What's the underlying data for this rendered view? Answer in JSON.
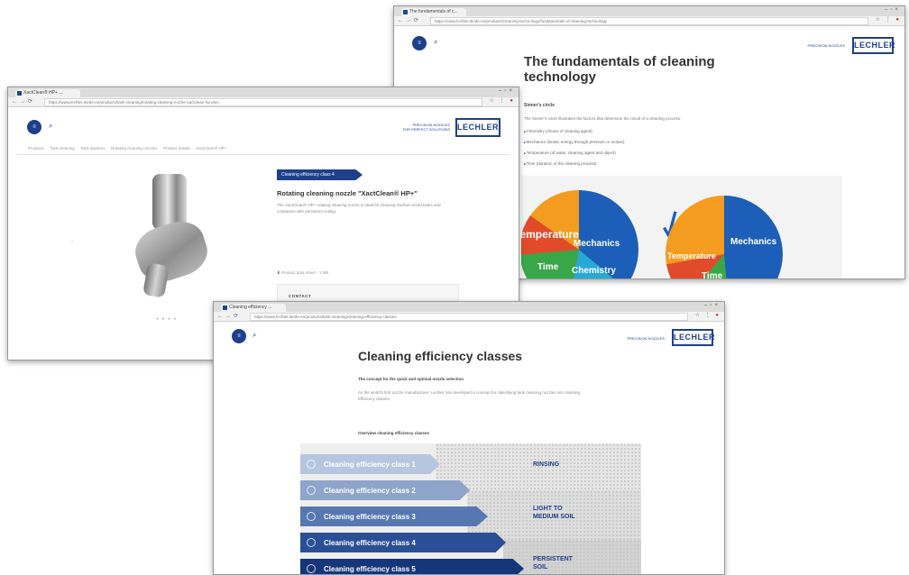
{
  "windows": {
    "back": {
      "tab_title": "The fundamentals of c...",
      "url": "https://www.lechler.de/de-en/products/cleaning-technology/fundamentals-of-cleaning-technology",
      "logo": "LECHLER",
      "tagline": "PRECISION NOZZLES",
      "title_line1": "The fundamentals of cleaning",
      "title_line2": "technology",
      "section_label": "Sinner's circle",
      "intro": "The Sinner's circle illustrates the factors that determine the result of a cleaning process.",
      "bullets": [
        "Chemistry (choice of cleaning agent)",
        "Mechanics (kinetic energy through pressure or motion)",
        "Temperature (of water, cleaning agent and object)",
        "Time (duration of the cleaning process)"
      ],
      "pie_left": {
        "temperature": "Temperature",
        "mechanics": "Mechanics",
        "time": "Time",
        "chemistry": "Chemistry"
      },
      "pie_right": {
        "temperature": "Temperature",
        "mechanics": "Mechanics",
        "time": "Time"
      }
    },
    "middle": {
      "tab_title": "XactClean® HP+ ...",
      "url": "https://www.lechler.de/de-en/products/tank-cleaning/rotating-cleaning-nozzle-xactclean-hp-plus",
      "logo": "LECHLER",
      "tagline": "PRECISION NOZZLES\nFOR PERFECT SOLUTIONS",
      "breadcrumbs": [
        "Products",
        "Tank cleaning",
        "Tank washers",
        "Rotating cleaning nozzles",
        "Product details",
        "XactClean® HP+"
      ],
      "badge": "Cleaning efficiency class 4",
      "product_title": "Rotating cleaning nozzle \"XactClean® HP+\"",
      "description": "The XactClean® HP+ rotating cleaning nozzle is ideal for cleaning medium-sized tanks and containers with persistent soiling.",
      "download_label": "Product data sheet",
      "download_size": "1 MB",
      "contact_label": "CONTACT"
    },
    "front": {
      "tab_title": "Cleaning efficiency ...",
      "url": "https://www.lechler.de/de-en/products/tank-cleaning/cleaning-efficiency-classes",
      "logo": "LECHLER",
      "tagline": "PRECISION NOZZLES",
      "title": "Cleaning efficiency classes",
      "subtitle": "The concept for the quick and optimal nozzle selection",
      "body": "As the world's first nozzle manufacturer, Lechler has developed a concept for classifying tank cleaning nozzles into cleaning efficiency classes.",
      "overview_label": "Overview cleaning efficiency classes",
      "classes": [
        "Cleaning efficiency class 1",
        "Cleaning efficiency class 2",
        "Cleaning efficiency class 3",
        "Cleaning efficiency class 4",
        "Cleaning efficiency class 5"
      ],
      "categories": {
        "rinsing": "RINSING",
        "light_line1": "LIGHT TO",
        "light_line2": "MEDIUM SOIL",
        "persistent_line1": "PERSISTENT",
        "persistent_line2": "SOIL"
      }
    }
  },
  "colors": {
    "brand_blue": "#1e3f8a",
    "class1": "#b7c6df",
    "class2": "#8ea4ca",
    "class3": "#5677b1",
    "class4": "#2a4f97",
    "class5": "#16367a"
  }
}
